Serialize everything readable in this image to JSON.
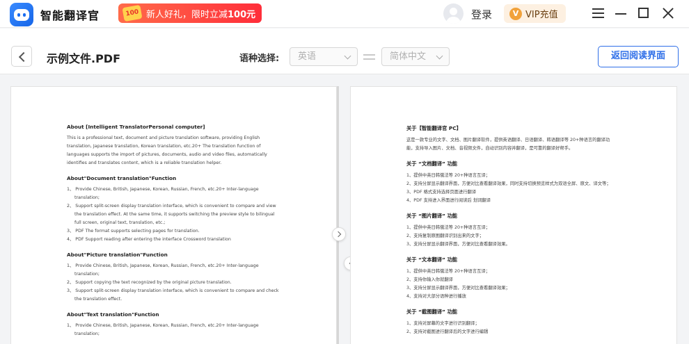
{
  "app": {
    "name": "智能翻译官"
  },
  "promo": {
    "coupon": "100",
    "text_prefix": "新人好礼，限时立减",
    "text_amount": "100元"
  },
  "header": {
    "login": "登录",
    "vip": "VIP充值"
  },
  "toolbar": {
    "title": "示例文件.PDF",
    "lang_label": "语种选择:",
    "source_lang": "英语",
    "target_lang": "简体中文",
    "return_button": "返回阅读界面"
  },
  "doc_en": {
    "s1_title": "About [Intelligent TranslatorPersonal computer]",
    "s1_p1": "This is a professional text, document and picture translation software, providing English",
    "s1_p2": "translation, Japanese translation, Korean translation, etc.20+ The translation function of",
    "s1_p3": "languages supports the import of pictures, documents, audio and video files, automatically",
    "s1_p4": "identifies and translates content, which is a reliable translation helper.",
    "s2_title": "About\"Document translation\"Function",
    "s2_l1a": "1、 Provide Chinese, British, Japanese, Korean, Russian, French, etc.20+ Inter-language",
    "s2_l1b": "translation;",
    "s2_l2a": "2、 Support split-screen display translation interface, which is convenient to compare and view",
    "s2_l2b": "the translation effect. At the same time, it supports switching the preview style to bilingual",
    "s2_l2c": "full screen, original text, translation, etc.;",
    "s2_l3": "3、 PDF The format supports selecting pages for translation.",
    "s2_l4": "4、 PDF Support reading after entering the interface Crossword translation",
    "s3_title": "About\"Picture translation\"Function",
    "s3_l1a": "1、 Provide Chinese, British, Japanese, Korean, Russian, French, etc.20+ Inter-language",
    "s3_l1b": "translation;",
    "s3_l2": "2、 Support copying the text recognized by the original picture translation.",
    "s3_l3a": "3、 Support split-screen display translation interface, which is convenient to compare and check",
    "s3_l3b": "the translation effect.",
    "s4_title": "About\"Text translation\"Function",
    "s4_l1a": "1、 Provide Chinese, British, Japanese, Korean, Russian, French, etc.20+ Inter-language",
    "s4_l1b": "translation;"
  },
  "doc_zh": {
    "s1_title": "关于【智能翻译官 PC】",
    "s1_p1": "这是一款专业的文字、文档、图片翻译软件，提供英语翻译、日语翻译、韩语翻译等 20+种语言的翻译功",
    "s1_p2": "能，支持导入图片、文档、音视频文件，自动识别内容并翻译，是可靠的翻译好帮手。",
    "s2_title": "关于 “文档翻译” 功能",
    "s2_l1": "1、提供中英日韩俄法等 20+种语言互译；",
    "s2_l2": "2、支持分屏显示翻译界面，方便对比查看翻译效果，同时支持切换预览样式为双语全屏、原文、译文等；",
    "s2_l3": "3、PDF 格式支持选择页面进行翻译",
    "s2_l4": "4、PDF 支持进入界面进行阅读后 划词翻译",
    "s3_title": "关于 “图片翻译” 功能",
    "s3_l1": "1、提供中英日韩俄法等 20+种语言互译；",
    "s3_l2": "2、支持复制原图翻译识别出来的文字；",
    "s3_l3": "3、支持分屏显示翻译界面，方便对比查看翻译效果。",
    "s4_title": "关于 “文本翻译” 功能",
    "s4_l1": "1、提供中英日韩俄法等 20+种语言互译；",
    "s4_l2": "2、支持你输入你就翻译",
    "s4_l3": "3、支持分屏显示翻译界面，方便对比查看翻译效果；",
    "s4_l4": "4、支持对大部分语种进行播放",
    "s5_title": "关于 “截图翻译” 功能",
    "s5_l1": "1、支持对屏幕的文字进行识别翻译；",
    "s5_l2": "2、支持对截图进行翻译后的文字进行编辑"
  }
}
